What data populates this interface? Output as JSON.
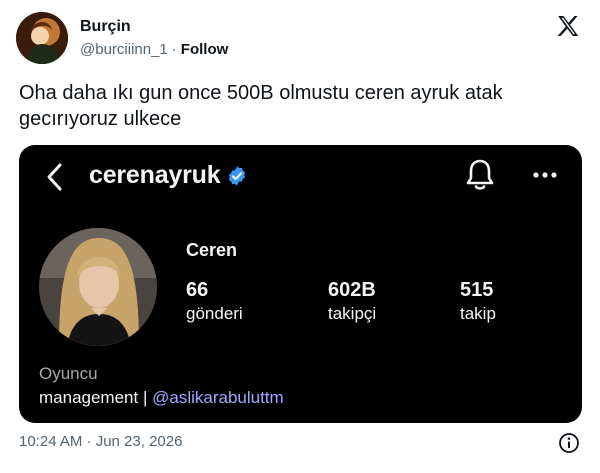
{
  "tweet": {
    "author": {
      "display_name": "Burçin",
      "handle": "@burciiinn_1",
      "separator": "·",
      "follow_label": "Follow",
      "avatar_icon": "user-avatar-photo"
    },
    "text": "Oha daha ıkı gun once 500B olmustu ceren ayruk atak gecırıyoruz ulkece",
    "timestamp": "10:24 AM · Jun 23, 2026",
    "logo_icon": "x-logo-icon",
    "info_icon": "info-icon"
  },
  "embedded_screenshot": {
    "username": "cerenayruk",
    "verified": true,
    "name": "Ceren",
    "stats": {
      "posts": {
        "value": "66",
        "label": "gönderi"
      },
      "followers": {
        "value": "602B",
        "label": "takipçi"
      },
      "following": {
        "value": "515",
        "label": "takip"
      }
    },
    "category": "Oyuncu",
    "bio_prefix": "management |",
    "bio_mention": "@aslikarabuluttm",
    "icons": [
      "back-arrow-icon",
      "verified-badge-icon",
      "bell-icon",
      "more-icon"
    ]
  },
  "colors": {
    "card_background": "#000000",
    "verified_blue": "#3897f0",
    "mention_color": "#a0a8ff",
    "muted_text": "#536471"
  }
}
